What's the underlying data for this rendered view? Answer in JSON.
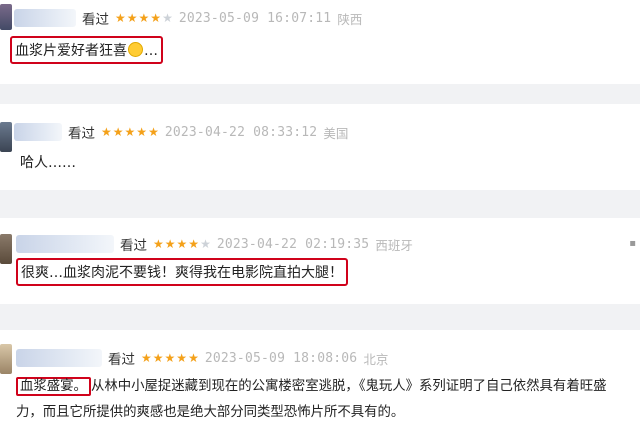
{
  "reviews": [
    {
      "watched": "看过",
      "rating": 4,
      "datetime": "2023-05-09 16:07:11",
      "location": "陕西",
      "text": "血浆片爱好者狂喜",
      "suffix": "…"
    },
    {
      "watched": "看过",
      "rating": 5,
      "datetime": "2023-04-22 08:33:12",
      "location": "美国",
      "text": "哈人……"
    },
    {
      "watched": "看过",
      "rating": 4,
      "datetime": "2023-04-22 02:19:35",
      "location": "西班牙",
      "text": "很爽…血浆肉泥不要钱！爽得我在电影院直拍大腿！"
    },
    {
      "watched": "看过",
      "rating": 5,
      "datetime": "2023-05-09 18:08:06",
      "location": "北京",
      "highlight": "血浆盛宴。",
      "text_line1": "从林中小屋捉迷藏到现在的公寓楼密室逃脱，《鬼玩人》系列证明了自己依然具有着旺盛",
      "text_line2": "力，而且它所提供的爽感也是绝大部分同类型恐怖片所不具有的。"
    }
  ]
}
